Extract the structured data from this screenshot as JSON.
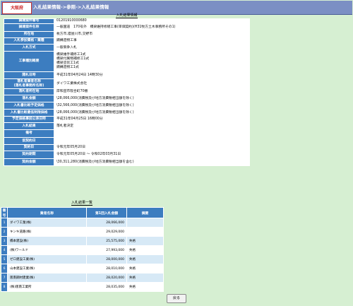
{
  "header": {
    "logo_text": "大阪府",
    "breadcrumb": "入札結果情報->参照->入札結果情報"
  },
  "detail": {
    "section_title": "入札結果情報",
    "rows": [
      {
        "label": "調達案件番号",
        "value": "01201910000680"
      },
      {
        "label": "調達案件名称",
        "value": "一般国道　170号外　橋梁維持修繕工事(単価契約)(H31牧方土木事務所その1)"
      },
      {
        "label": "所在地",
        "value": "枚方市,寝屋川市,交野市"
      },
      {
        "label": "入札参加資格・業種",
        "value": "鋼構造物工事"
      },
      {
        "label": "入札方式",
        "value": "一般競争入札"
      },
      {
        "label": "工事種別概要",
        "value": "橋梁維手補修工1式\n橋梁付属物補修工1式\n橋梁塗装工1式\n鋼構造物工1式"
      },
      {
        "label": "開札日時",
        "value": "平成31年04月24日 14時30分"
      },
      {
        "label": "落札者業者名称\n(落札者事務所名称)",
        "value": "ダイワ工業株式会社"
      },
      {
        "label": "落札者所在地",
        "value": "岸和田市阪合町70番"
      },
      {
        "label": "落札金額",
        "value": "\\28,066,000(消費税及び地方消費税相当額を除く)"
      },
      {
        "label": "入札書比較予定価格",
        "value": "\\32,566,000(消費税及び地方消費税相当額を除く)"
      },
      {
        "label": "入札書比較最低制限価格",
        "value": "\\28,066,000(消費税及び地方消費税相当額を除く)"
      },
      {
        "label": "予定価格事前公表日時",
        "value": "平成31年04月25日 16時00分"
      },
      {
        "label": "入札結果",
        "value": "落札者決定"
      },
      {
        "label": "備考",
        "value": ""
      },
      {
        "label": "仮契約日",
        "value": ""
      },
      {
        "label": "契約日",
        "value": "令和元年05月20日"
      },
      {
        "label": "契約期間",
        "value": "令和元年05月20日 ～ 令和02年03月31日"
      },
      {
        "label": "契約金額",
        "value": "\\30,311,280(消費税及び地方消費税相当額を含む)"
      }
    ]
  },
  "bid_list": {
    "section_title": "入札結果一覧",
    "columns": [
      "番号",
      "業者名称",
      "第1回入札金額",
      "摘要"
    ],
    "rows": [
      {
        "no": "1",
        "name": "ダイワ工業(株)",
        "amount": "28,066,000",
        "note": ""
      },
      {
        "no": "2",
        "name": "キンキ道路(株)",
        "amount": "29,029,000",
        "note": ""
      },
      {
        "no": "3",
        "name": "橋本建設(株)",
        "amount": "25,575,000",
        "note": "失格"
      },
      {
        "no": "4",
        "name": "(株)ワールド",
        "amount": "27,993,000",
        "note": "失格"
      },
      {
        "no": "5",
        "name": "ゼロ建設工業(株)",
        "amount": "28,000,000",
        "note": "失格"
      },
      {
        "no": "6",
        "name": "山本建設工業(株)",
        "amount": "28,010,000",
        "note": "失格"
      },
      {
        "no": "7",
        "name": "阪南鋼材建業(株)",
        "amount": "28,020,000",
        "note": "失格"
      },
      {
        "no": "8",
        "name": "(株)阪南工業所",
        "amount": "28,035,000",
        "note": "失格"
      }
    ]
  },
  "actions": {
    "back_label": "戻る"
  },
  "colors": {
    "page_bg": "#d6efd2",
    "header_bg": "#7b8fc4",
    "label_bg": "#3c7dc0",
    "row_alt_bg": "#d7e9f6",
    "logo_text": "#cc2222"
  }
}
